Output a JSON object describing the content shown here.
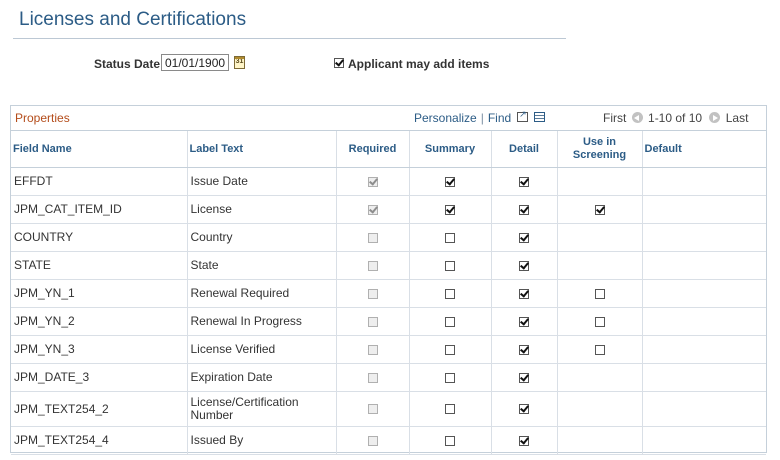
{
  "page": {
    "title": "Licenses and Certifications"
  },
  "status": {
    "label": "Status Date",
    "value": "01/01/1900",
    "calendar_icon": "calendar-icon",
    "calendar_glyph": "31"
  },
  "applicant": {
    "label": "Applicant may add items",
    "checked": true
  },
  "grid": {
    "caption": "Properties",
    "personalize": "Personalize",
    "find": "Find",
    "nav": {
      "first": "First",
      "range": "1-10 of 10",
      "last": "Last"
    },
    "columns": [
      "Field Name",
      "Label Text",
      "Required",
      "Summary",
      "Detail",
      "Use in Screening",
      "Default"
    ],
    "rows": [
      {
        "field": "EFFDT",
        "label": "Issue Date",
        "required": true,
        "summary": true,
        "detail": true,
        "screening": null
      },
      {
        "field": "JPM_CAT_ITEM_ID",
        "label": "License",
        "required": true,
        "summary": true,
        "detail": true,
        "screening": true
      },
      {
        "field": "COUNTRY",
        "label": "Country",
        "required": false,
        "summary": false,
        "detail": true,
        "screening": null
      },
      {
        "field": "STATE",
        "label": "State",
        "required": false,
        "summary": false,
        "detail": true,
        "screening": null
      },
      {
        "field": "JPM_YN_1",
        "label": "Renewal Required",
        "required": false,
        "summary": false,
        "detail": true,
        "screening": false
      },
      {
        "field": "JPM_YN_2",
        "label": "Renewal In Progress",
        "required": false,
        "summary": false,
        "detail": true,
        "screening": false
      },
      {
        "field": "JPM_YN_3",
        "label": "License Verified",
        "required": false,
        "summary": false,
        "detail": true,
        "screening": false
      },
      {
        "field": "JPM_DATE_3",
        "label": "Expiration Date",
        "required": false,
        "summary": false,
        "detail": true,
        "screening": null
      },
      {
        "field": "JPM_TEXT254_2",
        "label": "License/Certification Number",
        "required": false,
        "summary": false,
        "detail": true,
        "screening": null
      },
      {
        "field": "JPM_TEXT254_4",
        "label": "Issued By",
        "required": false,
        "summary": false,
        "detail": true,
        "screening": null
      }
    ]
  },
  "colors": {
    "title": "#2c5c86",
    "caption": "#b44c1a",
    "header_text": "#2c5c86",
    "border": "#c5d0da"
  }
}
